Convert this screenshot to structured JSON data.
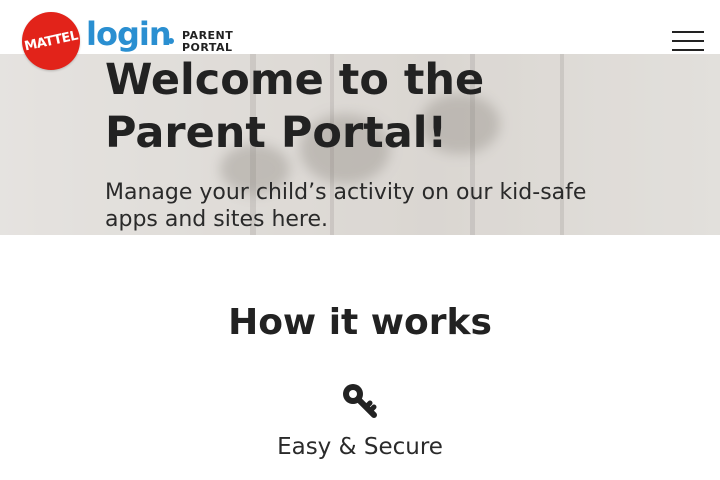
{
  "header": {
    "brand_badge": "MATTEL",
    "logo_word": "login",
    "portal_label_line1": "PARENT",
    "portal_label_line2": "PORTAL",
    "menu_icon": "hamburger-menu-icon"
  },
  "hero": {
    "title": "Welcome to the\nParent Portal!",
    "subtitle": "Manage your child’s activity on our kid-safe apps and sites here."
  },
  "how_it_works": {
    "title": "How it works",
    "features": [
      {
        "icon": "key-icon",
        "label": "Easy & Secure"
      }
    ]
  },
  "colors": {
    "brand_red": "#e2231a",
    "brand_blue": "#2a8fd1",
    "text_dark": "#222222"
  }
}
